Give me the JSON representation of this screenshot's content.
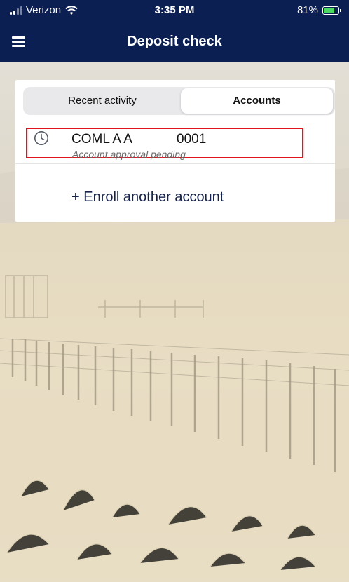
{
  "status_bar": {
    "carrier": "Verizon",
    "time": "3:35 PM",
    "battery_percent": "81%",
    "battery_level": 0.81
  },
  "nav": {
    "title": "Deposit check",
    "menu_icon": "hamburger-menu-icon"
  },
  "tabs": [
    {
      "label": "Recent activity",
      "selected": false
    },
    {
      "label": "Accounts",
      "selected": true
    }
  ],
  "accounts": [
    {
      "icon": "clock-icon",
      "name": "COML A A",
      "number": "0001",
      "status": "Account approval pending",
      "highlighted": true
    }
  ],
  "enroll_link": "+ Enroll another account",
  "colors": {
    "header": "#0b1f52",
    "highlight_border": "#e0141c",
    "link": "#16224a",
    "battery": "#4cd964"
  }
}
